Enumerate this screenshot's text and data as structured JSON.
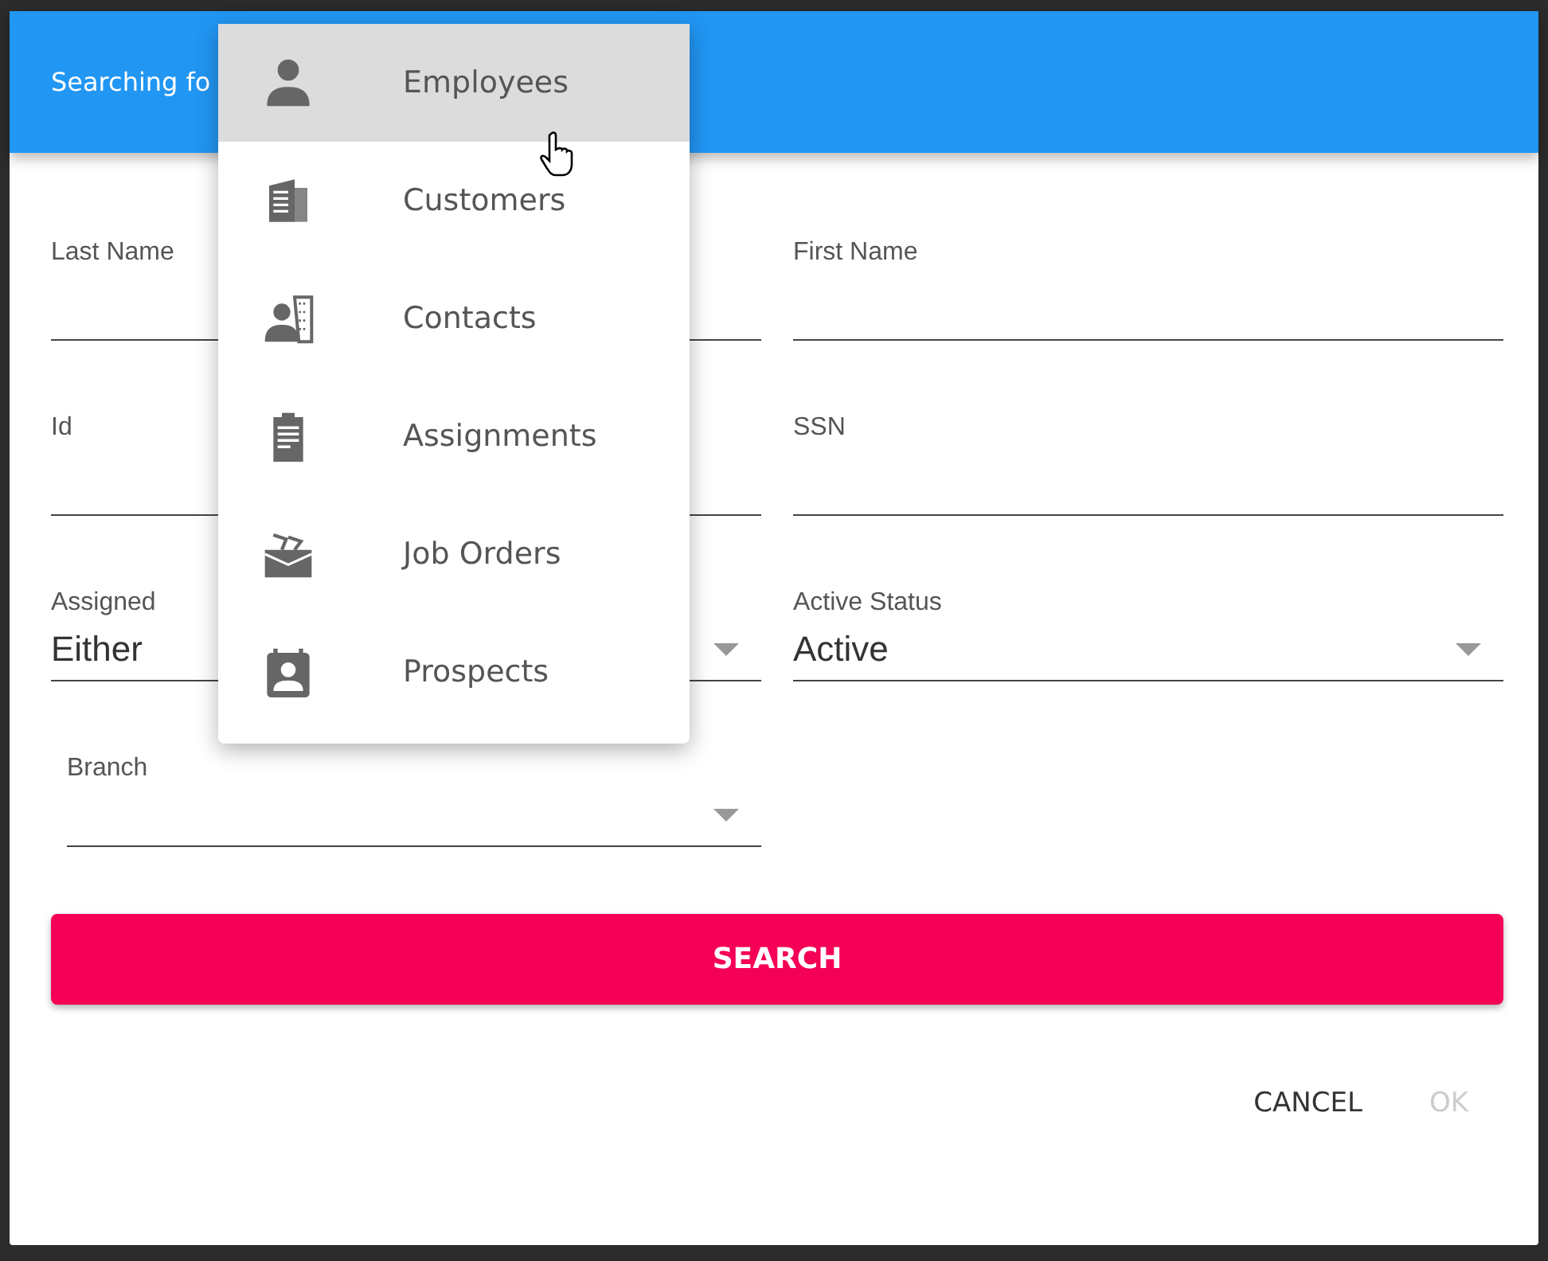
{
  "dialog": {
    "title": "Searching fo"
  },
  "fields": [
    {
      "kind": "text",
      "label": "Last Name"
    },
    {
      "kind": "text",
      "label": "First Name"
    },
    {
      "kind": "text",
      "label": "Id"
    },
    {
      "kind": "text",
      "label": "SSN"
    },
    {
      "kind": "select",
      "label": "Assigned",
      "value": "Either"
    },
    {
      "kind": "select",
      "label": "Active Status",
      "value": "Active"
    },
    {
      "kind": "select",
      "label": "Branch"
    }
  ],
  "search_button": "SEARCH",
  "footer_buttons": [
    {
      "label": "CANCEL",
      "disabled": false
    },
    {
      "label": "OK",
      "disabled": true
    }
  ],
  "menu": [
    {
      "kind": "person",
      "label": "Employees",
      "selected": true
    },
    {
      "kind": "building",
      "label": "Customers",
      "selected": false
    },
    {
      "kind": "contact",
      "label": "Contacts",
      "selected": false
    },
    {
      "kind": "clipboard",
      "label": "Assignments",
      "selected": false
    },
    {
      "kind": "briefcase",
      "label": "Job Orders",
      "selected": false
    },
    {
      "kind": "badge",
      "label": "Prospects",
      "selected": false
    }
  ]
}
